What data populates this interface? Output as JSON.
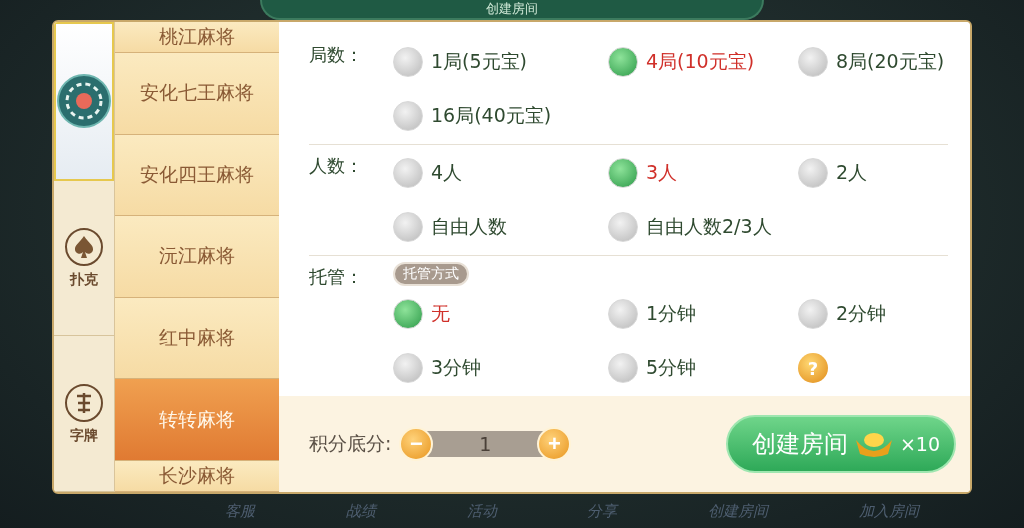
{
  "title": "创建房间",
  "categories": [
    {
      "kind": "mahjong",
      "selected": true
    },
    {
      "kind": "poker",
      "label": "扑克",
      "selected": false
    },
    {
      "kind": "zipai",
      "label": "字牌",
      "selected": false
    }
  ],
  "games": [
    {
      "label": "桃江麻将",
      "selected": false
    },
    {
      "label": "安化七王麻将",
      "selected": false
    },
    {
      "label": "安化四王麻将",
      "selected": false
    },
    {
      "label": "沅江麻将",
      "selected": false
    },
    {
      "label": "红中麻将",
      "selected": false
    },
    {
      "label": "转转麻将",
      "selected": true
    },
    {
      "label": "长沙麻将",
      "selected": false
    }
  ],
  "sections": [
    {
      "label": "局数：",
      "options": [
        {
          "kind": "radio",
          "label": "1局(5元宝)",
          "selected": false
        },
        {
          "kind": "radio",
          "label": "4局(10元宝)",
          "selected": true
        },
        {
          "kind": "radio",
          "label": "8局(20元宝)",
          "selected": false
        },
        {
          "kind": "radio",
          "label": "16局(40元宝)",
          "selected": false
        }
      ]
    },
    {
      "label": "人数：",
      "options": [
        {
          "kind": "radio",
          "label": "4人",
          "selected": false
        },
        {
          "kind": "radio",
          "label": "3人",
          "selected": true
        },
        {
          "kind": "radio",
          "label": "2人",
          "selected": false
        },
        {
          "kind": "radio",
          "label": "自由人数",
          "selected": false
        },
        {
          "kind": "radio",
          "label": "自由人数2/3人",
          "selected": false
        }
      ]
    },
    {
      "label": "托管：",
      "badge": "托管方式",
      "options": [
        {
          "kind": "radio",
          "label": "无",
          "selected": true
        },
        {
          "kind": "radio",
          "label": "1分钟",
          "selected": false
        },
        {
          "kind": "radio",
          "label": "2分钟",
          "selected": false
        },
        {
          "kind": "radio",
          "label": "3分钟",
          "selected": false
        },
        {
          "kind": "radio",
          "label": "5分钟",
          "selected": false
        },
        {
          "kind": "help",
          "label": "?"
        }
      ]
    }
  ],
  "footer": {
    "score_label": "积分底分:",
    "minus": "−",
    "value": "1",
    "plus": "+",
    "create_label": "创建房间",
    "cost": "×10"
  },
  "bottom_bar": [
    "客服",
    "战绩",
    "活动",
    "分享",
    "创建房间",
    "加入房间"
  ]
}
